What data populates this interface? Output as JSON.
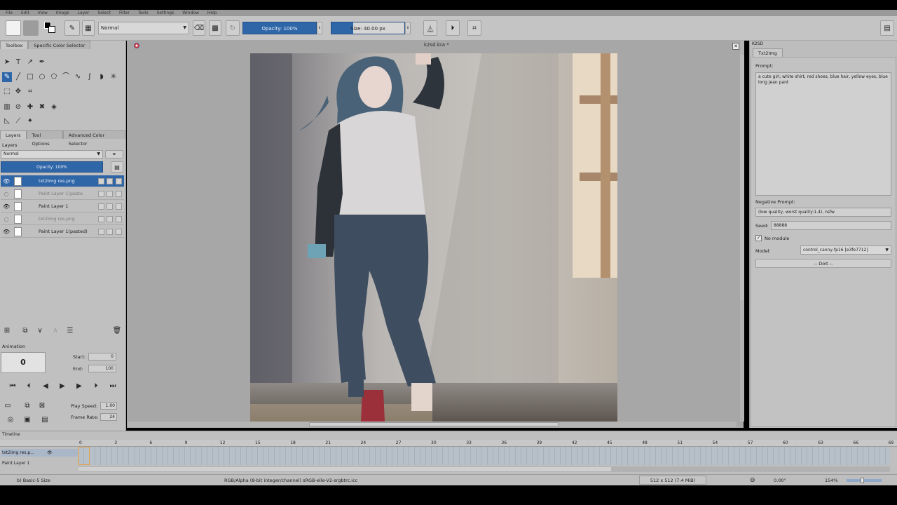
{
  "menu": [
    "File",
    "Edit",
    "View",
    "Image",
    "Layer",
    "Select",
    "Filter",
    "Tools",
    "Settings",
    "Window",
    "Help"
  ],
  "toolbar": {
    "blend_mode": "Normal",
    "opacity": "Opacity: 100%",
    "size": "Size: 40.00 px"
  },
  "left_dock": {
    "top_tabs": [
      "Toolbox",
      "Specific Color Selector"
    ],
    "mid_tabs": [
      "Layers",
      "Tool Options",
      "Advanced Color Selector"
    ],
    "layers_title": "Layers",
    "layer_blend": "Normal",
    "layer_opacity": "Opacity:  100%",
    "layers": [
      {
        "name": "txt2img res.png",
        "visible": true,
        "selected": true
      },
      {
        "name": "Paint Layer 1(paste",
        "visible": false,
        "selected": false
      },
      {
        "name": "Paint Layer 1",
        "visible": true,
        "selected": false
      },
      {
        "name": "txt2img res.png",
        "visible": false,
        "selected": false
      },
      {
        "name": "Paint Layer 1(pasted)",
        "visible": true,
        "selected": false
      }
    ],
    "animation": {
      "title": "Animation",
      "frame": "0",
      "start_label": "Start:",
      "start": "0",
      "end_label": "End:",
      "end": "100",
      "play_speed_label": "Play Speed:",
      "play_speed": "1.00",
      "frame_rate_label": "Frame Rate:",
      "frame_rate": "24"
    }
  },
  "canvas": {
    "document_title": "k2sd.kra *"
  },
  "right_dock": {
    "panel_title": "K2SD",
    "tab": "Txt2Img",
    "prompt_label": "Prompt:",
    "prompt": "a cute girl, white shirt, red shoes, blue hair, yellow eyes, blue long jean pant",
    "negative_label": "Negative Prompt:",
    "negative": "(low quality, worst quality:1.4), nsfw",
    "seed_label": "Seed:",
    "seed": "88888",
    "no_module_label": "No module",
    "model_label": "Model:",
    "model": "control_canny-fp16 [e3fe7712]",
    "doit": "-- DoIt --"
  },
  "timeline": {
    "title": "Timeline",
    "frames": [
      "0",
      "3",
      "6",
      "9",
      "12",
      "15",
      "18",
      "21",
      "24",
      "27",
      "30",
      "33",
      "36",
      "39",
      "42",
      "45",
      "48",
      "51",
      "54",
      "57",
      "60",
      "63",
      "66",
      "69"
    ],
    "rows": [
      "txt2img res.p...",
      "Paint Layer 1"
    ]
  },
  "status": {
    "brush": "b) Basic-5 Size",
    "color_info": "RGB/Alpha (8-bit integer/channel)  sRGB-elle-V2-srgbtrc.icc",
    "image_size": "512 x 512 (7.4 MiB)",
    "rotation": "0.00°",
    "zoom": "154%"
  },
  "colors": {
    "accent": "#2f66a8",
    "panel": "#c0c0c0",
    "canvas_bg": "#a7a7a7"
  }
}
